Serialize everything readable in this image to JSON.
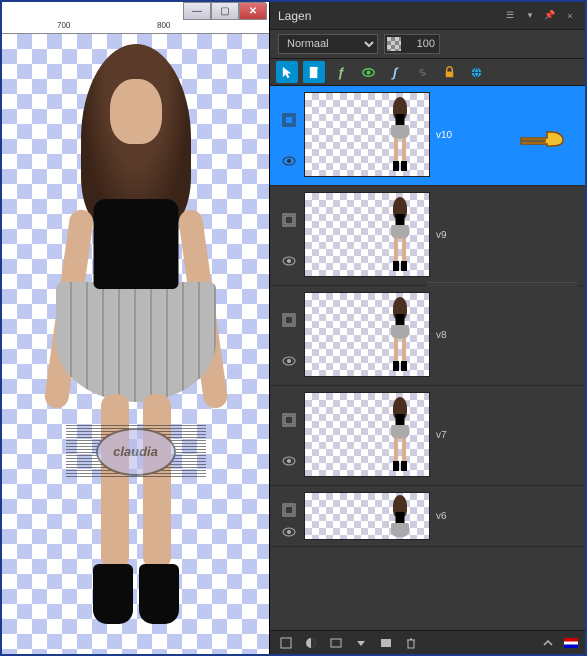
{
  "window": {
    "minimize": "—",
    "maximize": "▢",
    "close": "✕"
  },
  "ruler": {
    "marks": [
      "700",
      "800"
    ]
  },
  "watermark_text": "claudia",
  "panel": {
    "title": "Lagen",
    "blend_mode": "Normaal",
    "opacity": "100",
    "toolbar_icons": [
      "arrow",
      "doc",
      "fx",
      "eye",
      "fxscript",
      "link",
      "lock",
      "world"
    ],
    "layers": [
      {
        "name": "v10",
        "selected": true
      },
      {
        "name": "v9",
        "selected": false
      },
      {
        "name": "v8",
        "selected": false
      },
      {
        "name": "v7",
        "selected": false
      },
      {
        "name": "v6",
        "selected": false
      }
    ]
  }
}
